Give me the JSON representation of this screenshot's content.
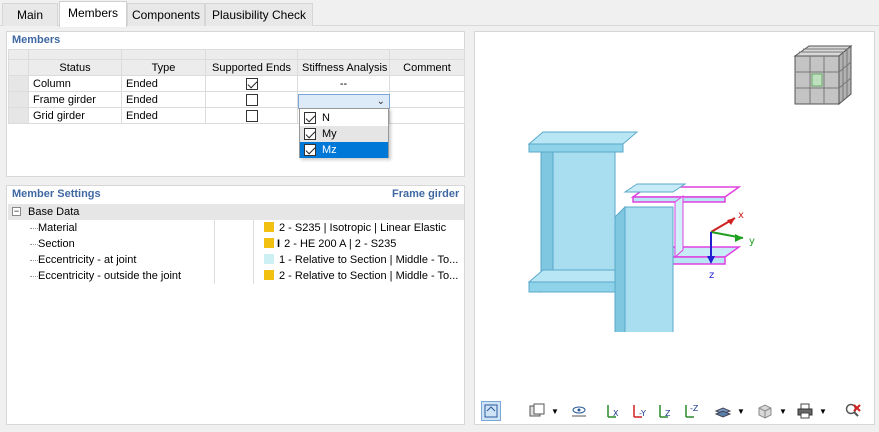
{
  "tabs": [
    "Main",
    "Members",
    "Components",
    "Plausibility Check"
  ],
  "members": {
    "title": "Members",
    "columns": [
      "Status",
      "Type",
      "Supported Ends",
      "Stiffness Analysis",
      "Comment"
    ],
    "rows": [
      {
        "status": "Column",
        "type": "Ended",
        "supported": true,
        "stiffness": "--",
        "comment": ""
      },
      {
        "status": "Frame girder",
        "type": "Ended",
        "supported": false,
        "stiffness": "",
        "comment": ""
      },
      {
        "status": "Grid girder",
        "type": "Ended",
        "supported": false,
        "stiffness": "",
        "comment": ""
      }
    ],
    "dropdown": [
      {
        "label": "N",
        "checked": true
      },
      {
        "label": "My",
        "checked": true
      },
      {
        "label": "Mz",
        "checked": true
      }
    ]
  },
  "member_settings": {
    "title": "Member Settings",
    "context": "Frame girder",
    "group": "Base Data",
    "items": [
      {
        "label": "Material",
        "value": "2 - S235 | Isotropic | Linear Elastic",
        "color": "#f2c010"
      },
      {
        "label": "Section",
        "value": "2 - HE 200 A | 2 - S235",
        "color": "#f2c010"
      },
      {
        "label": "Eccentricity - at joint",
        "value": "1 - Relative to Section | Middle - To...",
        "color": "#cdf0f5"
      },
      {
        "label": "Eccentricity - outside the joint",
        "value": "2 - Relative to Section | Middle - To...",
        "color": "#f2c010"
      }
    ]
  },
  "axes": {
    "x": "x",
    "y": "y",
    "z": "z"
  },
  "colors": {
    "accent": "#3f68a3",
    "steel": "#8fd3ea",
    "highlight": "#e040e0",
    "selection": "#0078d7"
  }
}
